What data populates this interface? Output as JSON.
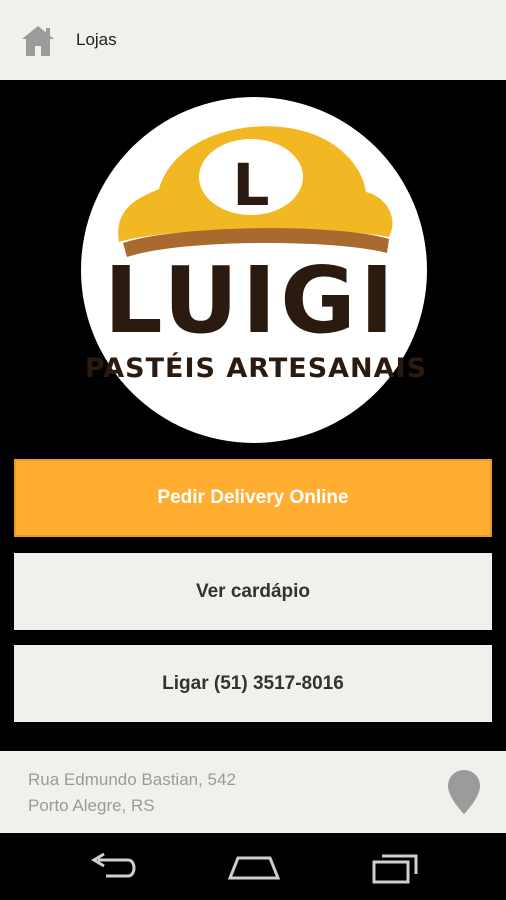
{
  "appbar": {
    "title": "Lojas",
    "icon": "home-icon"
  },
  "logo": {
    "brand_letter": "L",
    "brand_name": "LUIGI",
    "tagline": "PASTÉIS ARTESANAIS",
    "cap_color": "#f2b824",
    "brim_color": "#a86a2e",
    "text_color": "#2a1a10"
  },
  "actions": {
    "delivery_label": "Pedir Delivery Online",
    "menu_label": "Ver cardápio",
    "call_label": "Ligar (51) 3517-8016"
  },
  "address": {
    "line1": "Rua Edmundo Bastian, 542",
    "line2": "Porto Alegre, RS",
    "icon": "map-pin-icon"
  },
  "colors": {
    "accent": "#ffae32",
    "surface": "#f1f0ec",
    "background": "#000000"
  },
  "navbar": {
    "icons": [
      "back-icon",
      "home-nav-icon",
      "recent-apps-icon"
    ]
  }
}
